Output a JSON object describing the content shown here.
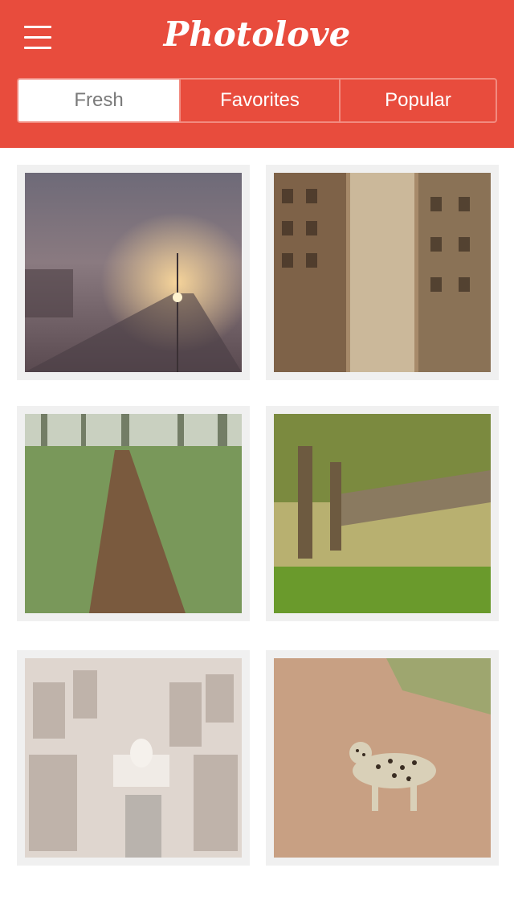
{
  "app": {
    "title": "Photolove"
  },
  "header": {
    "menu_icon": "hamburger-menu-icon",
    "background": "#e84c3d"
  },
  "tabs": [
    {
      "label": "Fresh",
      "active": true
    },
    {
      "label": "Favorites",
      "active": false
    },
    {
      "label": "Popular",
      "active": false
    }
  ],
  "photos": [
    {
      "subject": "foggy railway at night"
    },
    {
      "subject": "city fire escapes between buildings"
    },
    {
      "subject": "forest path in moss"
    },
    {
      "subject": "wooden pier in reeds"
    },
    {
      "subject": "aerial city with capitol building"
    },
    {
      "subject": "leopard on dirt road"
    }
  ]
}
